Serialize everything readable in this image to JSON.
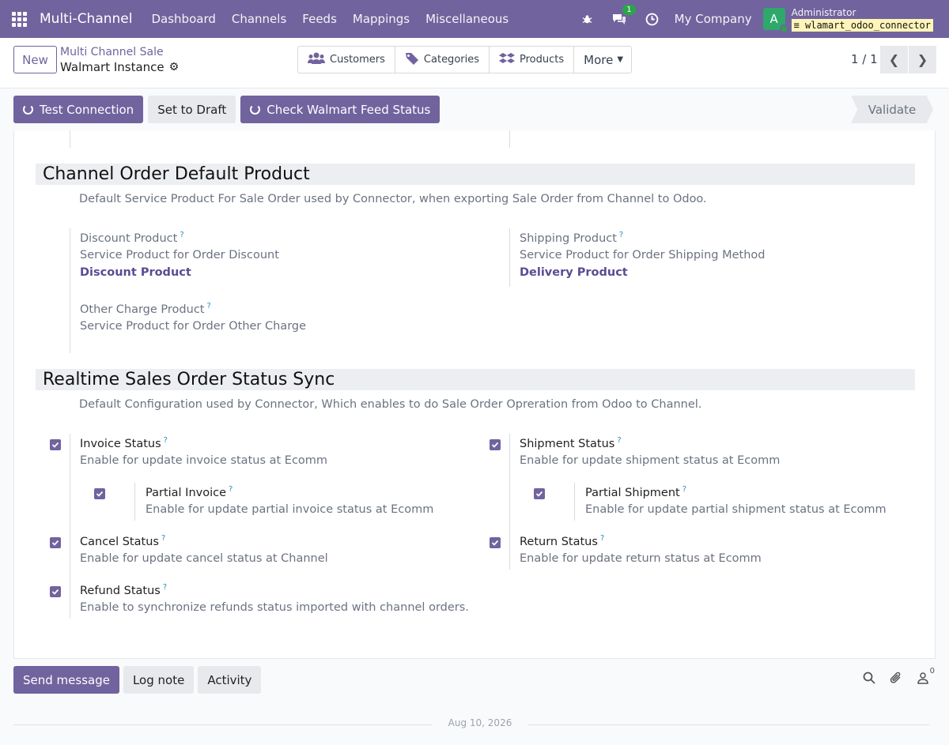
{
  "topnav": {
    "app_name": "Multi-Channel",
    "menu": [
      "Dashboard",
      "Channels",
      "Feeds",
      "Mappings",
      "Miscellaneous"
    ],
    "messages_badge": "1",
    "company": "My Company",
    "avatar_letter": "A",
    "user_name": "Administrator",
    "db_name": "wlamart_odoo_connector"
  },
  "control": {
    "new_label": "New",
    "breadcrumb": "Multi Channel Sale",
    "record_title": "Walmart Instance",
    "smart_buttons": [
      "Customers",
      "Categories",
      "Products"
    ],
    "more_label": "More",
    "pager": "1 / 1"
  },
  "actions": {
    "test_connection": "Test Connection",
    "set_to_draft": "Set to Draft",
    "check_feed": "Check Walmart Feed Status",
    "validate": "Validate"
  },
  "section_default_product": {
    "title": "Channel Order Default Product",
    "description": "Default Service Product For Sale Order used by Connector, when exporting Sale Order from Channel to Odoo.",
    "discount": {
      "label": "Discount Product",
      "help": "Service Product for Order Discount",
      "value": "Discount Product"
    },
    "shipping": {
      "label": "Shipping Product",
      "help": "Service Product for Order Shipping Method",
      "value": "Delivery Product"
    },
    "other": {
      "label": "Other Charge Product",
      "help": "Service Product for Order Other Charge"
    }
  },
  "section_status_sync": {
    "title": "Realtime Sales Order Status Sync",
    "description": "Default Configuration used by Connector, Which enables to do Sale Order Opreration from Odoo to Channel.",
    "invoice": {
      "label": "Invoice Status",
      "help": "Enable for update invoice status at Ecomm"
    },
    "partial_invoice": {
      "label": "Partial Invoice",
      "help": "Enable for update partial invoice status at Ecomm"
    },
    "cancel": {
      "label": "Cancel Status",
      "help": "Enable for update cancel status at Channel"
    },
    "refund": {
      "label": "Refund Status",
      "help": "Enable to synchronize refunds status imported with channel orders."
    },
    "shipment": {
      "label": "Shipment Status",
      "help": "Enable for update shipment status at Ecomm"
    },
    "partial_shipment": {
      "label": "Partial Shipment",
      "help": "Enable for update partial shipment status at Ecomm"
    },
    "return": {
      "label": "Return Status",
      "help": "Enable for update return status at Ecomm"
    }
  },
  "chatter": {
    "send_message": "Send message",
    "log_note": "Log note",
    "activity": "Activity",
    "followers_count": "0",
    "date": "Aug 10, 2026"
  }
}
